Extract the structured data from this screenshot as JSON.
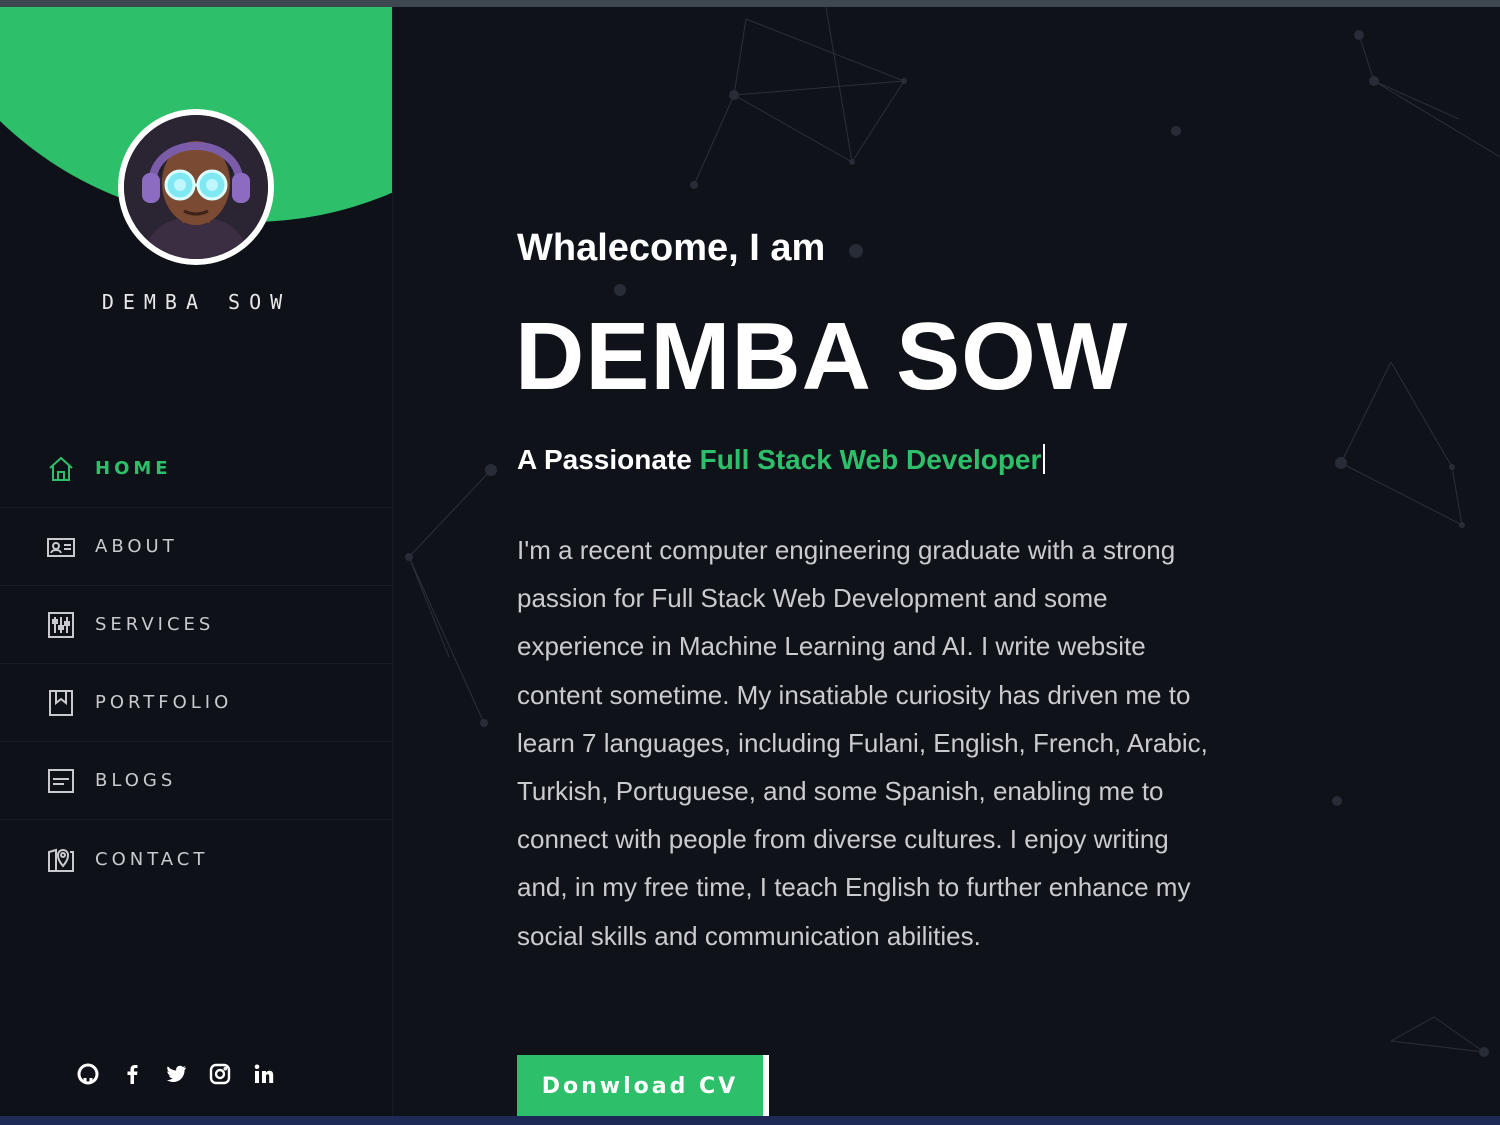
{
  "profile": {
    "name": "DEMBA SOW",
    "avatar_icon": "person-with-headphones-avatar"
  },
  "nav": {
    "items": [
      {
        "label": "HOME",
        "icon": "home-icon",
        "active": true
      },
      {
        "label": "ABOUT",
        "icon": "id-card-icon",
        "active": false
      },
      {
        "label": "SERVICES",
        "icon": "sliders-icon",
        "active": false
      },
      {
        "label": "PORTFOLIO",
        "icon": "bookmark-icon",
        "active": false
      },
      {
        "label": "BLOGS",
        "icon": "blog-icon",
        "active": false
      },
      {
        "label": "CONTACT",
        "icon": "map-pin-icon",
        "active": false
      }
    ]
  },
  "social": [
    "github-icon",
    "facebook-icon",
    "twitter-icon",
    "instagram-icon",
    "linkedin-icon"
  ],
  "hero": {
    "greeting": "Whalecome, I am",
    "name": "DEMBA SOW",
    "tagline_prefix": "A Passionate",
    "tagline_role": "Full Stack Web Developer",
    "bio": "I'm a recent computer engineering graduate with a strong passion for Full Stack Web Development and some experience in Machine Learning and AI. I write website content sometime. My insatiable curiosity has driven me to learn 7 languages, including Fulani, English, French, Arabic, Turkish, Portuguese, and some Spanish, enabling me to connect with people from diverse cultures. I enjoy writing and, in my free time, I teach English to further enhance my social skills and communication abilities.",
    "cta_label": "Donwload CV"
  },
  "colors": {
    "accent": "#2ebf6b",
    "background": "#10121a",
    "sidebar": "#0e1118",
    "text": "#ffffff",
    "muted_text": "#c9cbcf"
  }
}
